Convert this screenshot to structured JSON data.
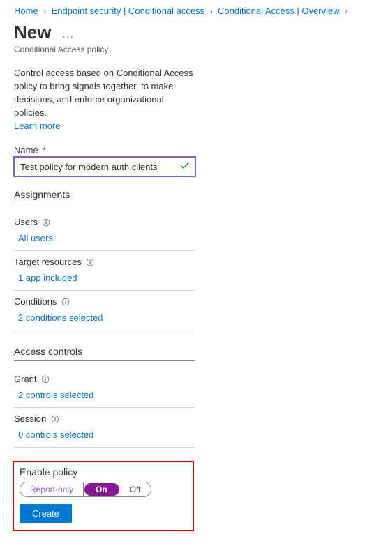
{
  "breadcrumb": {
    "items": [
      {
        "label": "Home"
      },
      {
        "label": "Endpoint security | Conditional access"
      },
      {
        "label": "Conditional Access | Overview"
      }
    ]
  },
  "header": {
    "title": "New",
    "subtitle": "Conditional Access policy"
  },
  "intro": {
    "text": "Control access based on Conditional Access policy to bring signals together, to make decisions, and enforce organizational policies.",
    "learn_more": "Learn more"
  },
  "name": {
    "label": "Name",
    "value": "Test policy for modern auth clients"
  },
  "sections": {
    "assignments": {
      "title": "Assignments",
      "users": {
        "label": "Users",
        "value": "All users"
      },
      "target": {
        "label": "Target resources",
        "value": "1 app included"
      },
      "conditions": {
        "label": "Conditions",
        "value": "2 conditions selected"
      }
    },
    "access": {
      "title": "Access controls",
      "grant": {
        "label": "Grant",
        "value": "2 controls selected"
      },
      "session": {
        "label": "Session",
        "value": "0 controls selected"
      }
    }
  },
  "footer": {
    "enable_label": "Enable policy",
    "options": {
      "report": "Report-only",
      "on": "On",
      "off": "Off"
    },
    "create": "Create"
  }
}
